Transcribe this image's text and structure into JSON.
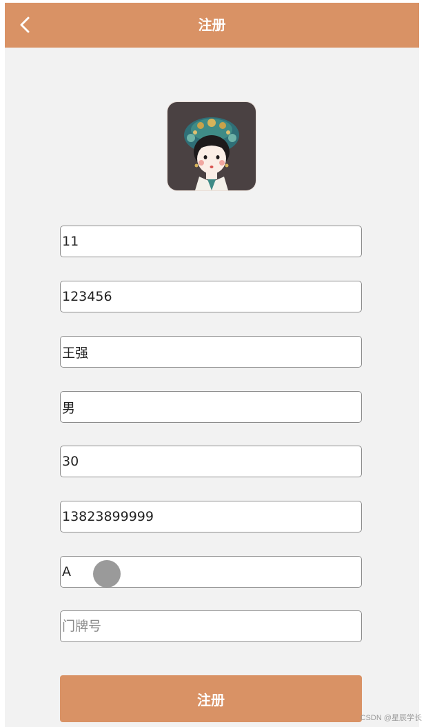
{
  "header": {
    "title": "注册",
    "back_icon": "chevron-left-icon"
  },
  "avatar": {
    "description_icon": "avatar-illustration"
  },
  "form": {
    "fields": [
      {
        "value": "11",
        "placeholder": ""
      },
      {
        "value": "123456",
        "placeholder": ""
      },
      {
        "value": "王强",
        "placeholder": ""
      },
      {
        "value": "男",
        "placeholder": ""
      },
      {
        "value": "30",
        "placeholder": ""
      },
      {
        "value": "13823899999",
        "placeholder": ""
      },
      {
        "value": "A",
        "placeholder": ""
      },
      {
        "value": "",
        "placeholder": "门牌号"
      }
    ],
    "submit_label": "注册"
  },
  "watermark": "CSDN @星辰学长",
  "colors": {
    "accent": "#d99265",
    "background": "#f2f2f2"
  }
}
